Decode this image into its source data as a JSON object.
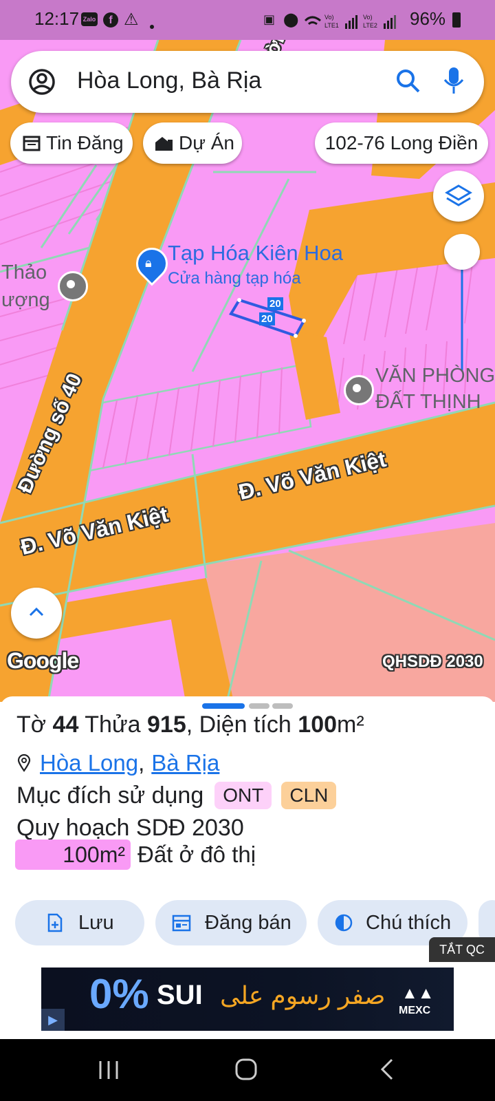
{
  "status_bar": {
    "time": "12:17",
    "battery": "96%",
    "app_badge": "Zalo"
  },
  "search": {
    "query": "Hòa Long, Bà Rịa"
  },
  "chips": {
    "tin_dang": "Tin Đăng",
    "du_an": "Dự Án",
    "location": "102-76 Long Điền"
  },
  "map": {
    "poi_1_name": "Tạp Hóa Kiên Hoa",
    "poi_1_type": "Cửa hàng tạp hóa",
    "poi_2_line1": "VĂN PHÒNG",
    "poi_2_line2": "ĐẤT THỊNH",
    "poi_3_line1": "Thảo",
    "poi_3_line2": "ượng",
    "road_1": "Đường số 40",
    "road_2": "Đ. Võ Văn Kiệt",
    "road_3": "Đ. Võ Văn Kiệt",
    "road_4": "Đường",
    "parcel_dim_1": "20",
    "parcel_dim_2": "20",
    "google": "Google",
    "layer_name": "QHSDĐ 2030"
  },
  "sheet": {
    "to_label": "Tờ",
    "to_value": "44",
    "thua_label": "Thửa",
    "thua_value": "915",
    "area_label": ", Diện tích",
    "area_value": "100",
    "area_unit": "m²",
    "commune": "Hòa Long",
    "separator": ",",
    "city": "Bà Rịa",
    "purpose_label": "Mục đích sử dụng",
    "tag_1": "ONT",
    "tag_2": "CLN",
    "plan_title": "Quy hoạch SDĐ 2030",
    "plan_area": "100m²",
    "plan_desc": "Đất ở đô thị"
  },
  "actions": {
    "save": "Lưu",
    "post_sale": "Đăng bán",
    "legend": "Chú thích"
  },
  "ad": {
    "close_ads": "TẮT QC",
    "headline": "SUI",
    "arabic": "صفر رسوم على",
    "percent": "0%",
    "brand": "MEXC"
  },
  "colors": {
    "residential_pink": "#f99af5",
    "road_orange": "#f6a330",
    "parcel_line": "#8fd9b5",
    "salmon": "#f8a79f",
    "accent_blue": "#1a73e8",
    "tag_ont_bg": "#fdd1f9",
    "tag_cln_bg": "#fcd09a"
  }
}
